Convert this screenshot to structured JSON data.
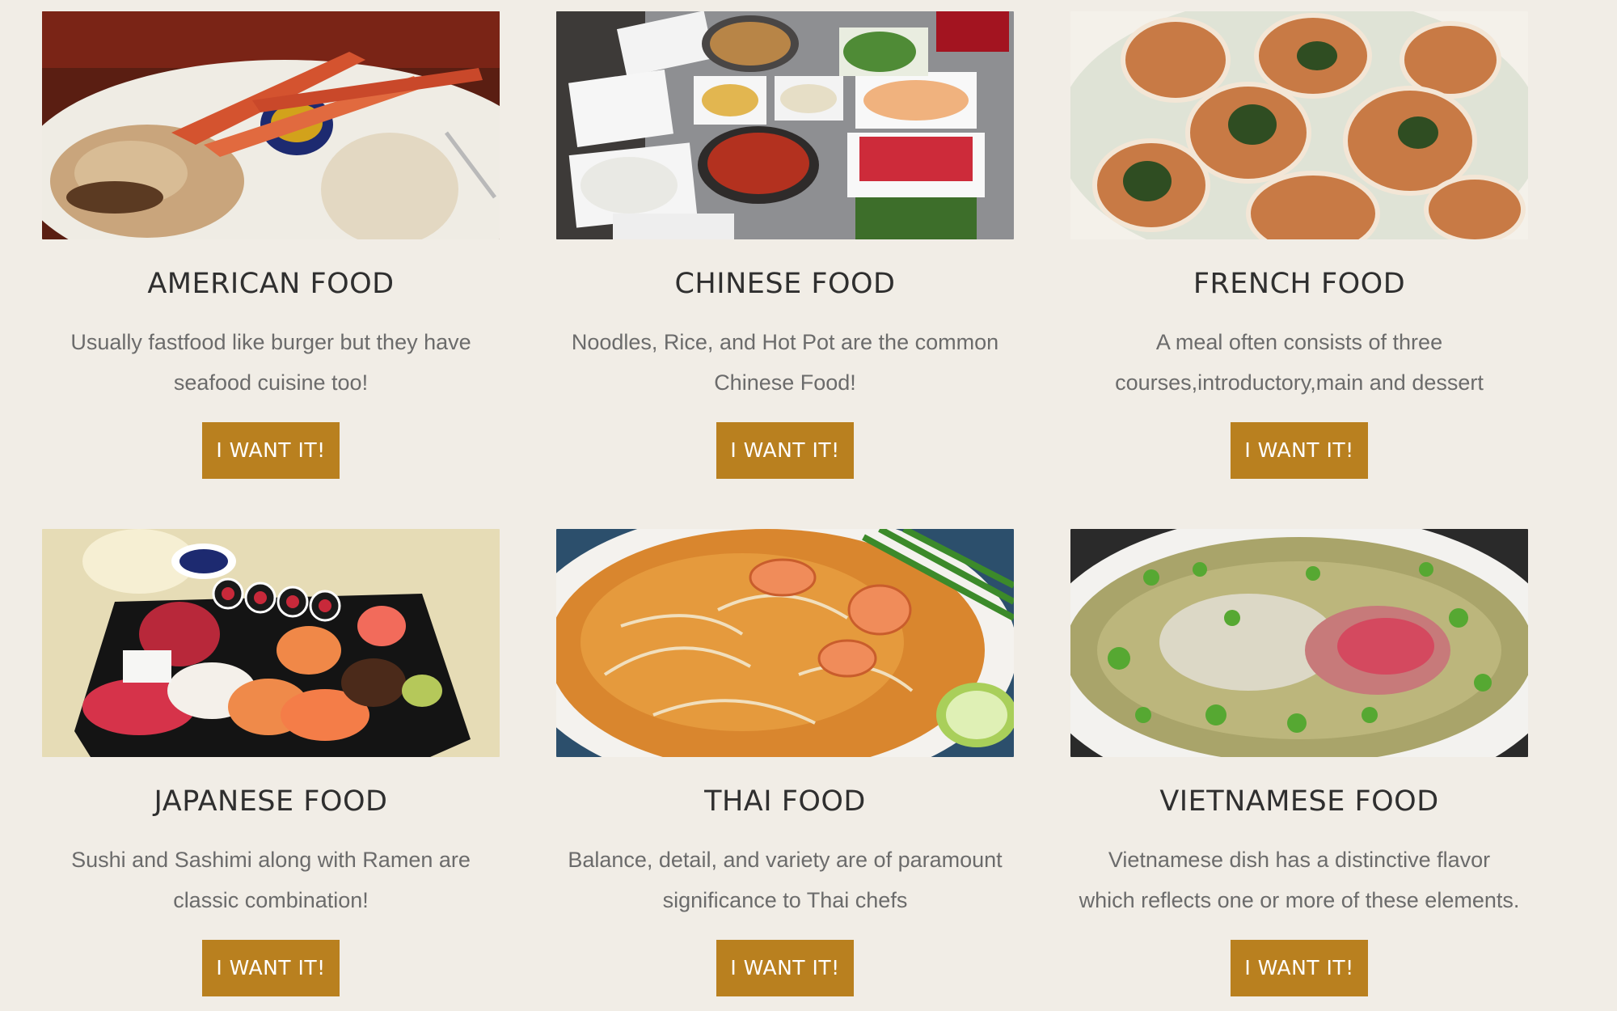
{
  "button_label": "I WANT IT!",
  "colors": {
    "background": "#f1ede6",
    "button": "#b9801f",
    "title": "#2f2f2f",
    "text": "#6b6b6b"
  },
  "cards": [
    {
      "title": "AMERICAN FOOD",
      "desc_line1": "Usually fastfood like burger but they have",
      "desc_line2": "seafood cuisine too!",
      "image": "plate of crab legs, shrimp and mashed potatoes"
    },
    {
      "title": "CHINESE FOOD",
      "desc_line1": "Noodles, Rice, and Hot Pot are the common",
      "desc_line2": "Chinese Food!",
      "image": "hot pot table spread"
    },
    {
      "title": "FRENCH FOOD",
      "desc_line1": "A meal often consists of three",
      "desc_line2": "courses,introductory,main and dessert",
      "image": "escargot in shells"
    },
    {
      "title": "JAPANESE FOOD",
      "desc_line1": "Sushi and Sashimi along with Ramen are",
      "desc_line2": "classic combination!",
      "image": "sushi and sashimi platter"
    },
    {
      "title": "THAI FOOD",
      "desc_line1": "Balance, detail, and variety are of paramount",
      "desc_line2": "significance to Thai chefs",
      "image": "pad thai with shrimp and lime"
    },
    {
      "title": "VIETNAMESE FOOD",
      "desc_line1": "Vietnamese dish has a distinctive flavor",
      "desc_line2": "which reflects one or more of these elements.",
      "image": "pho noodle soup with beef"
    }
  ]
}
